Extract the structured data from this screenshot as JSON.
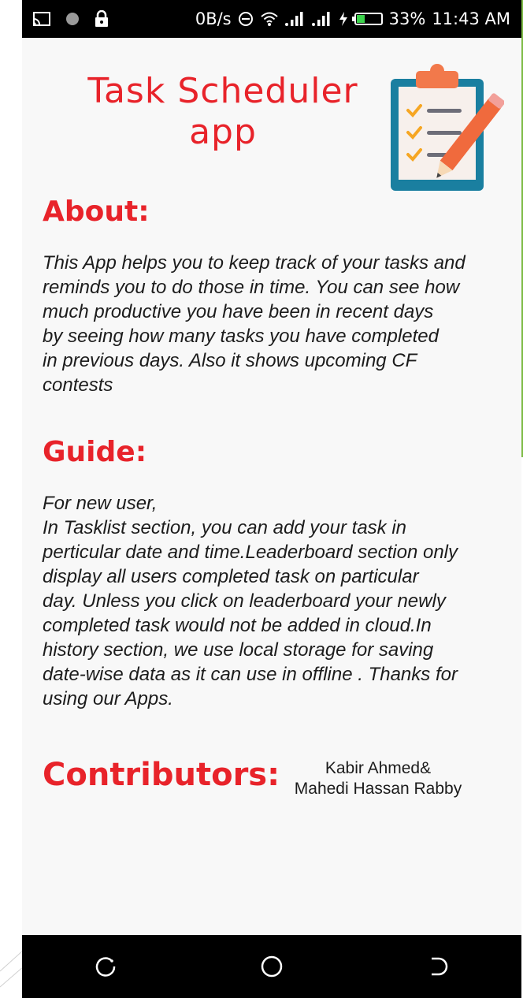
{
  "status_bar": {
    "network_speed": "0B/s",
    "battery_percent": "33%",
    "battery_level": 0.33,
    "time": "11:43 AM"
  },
  "header": {
    "title": "Task Scheduler\napp"
  },
  "about": {
    "heading": "About:",
    "body": "This App helps you to keep track of your tasks and\nreminds you to do those in time. You can see how\nmuch productive you have been in recent days\nby seeing how many tasks you have completed\nin previous days. Also it shows upcoming CF\ncontests"
  },
  "guide": {
    "heading": "Guide:",
    "body": "For new user,\n In Tasklist section, you can add your task in\nperticular date and time.Leaderboard section only\ndisplay all users completed task on particular\nday. Unless you click on leaderboard your newly\ncompleted task would not be added in cloud.In\nhistory section, we use local storage for saving\ndate-wise data as it can use in offline . Thanks for\nusing our Apps."
  },
  "contributors": {
    "heading": "Contributors:",
    "names": "Kabir Ahmed&\nMahedi Hassan Rabby"
  },
  "icons": {
    "status_left": [
      "cast-icon",
      "record-dot-icon",
      "lock-icon"
    ],
    "status_right": [
      "data-saver-icon",
      "wifi-icon",
      "signal-icon",
      "signal-icon-2",
      "charging-icon",
      "battery-icon"
    ],
    "nav": [
      "recent-apps-icon",
      "home-icon",
      "back-icon"
    ],
    "logo": "clipboard-checklist-icon"
  },
  "colors": {
    "accent": "#e8232a",
    "logo_board": "#1a7fa0",
    "logo_clip": "#f2794b",
    "logo_pencil": "#f06a3d",
    "logo_check": "#f6a623",
    "battery_fill": "#3cd34c"
  }
}
